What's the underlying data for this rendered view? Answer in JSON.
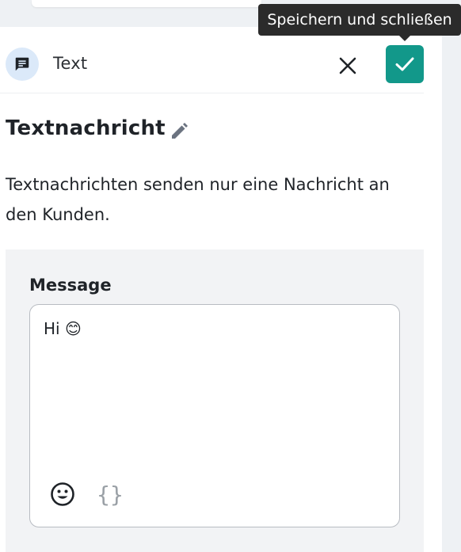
{
  "header": {
    "type_icon": "message-icon",
    "type_label": "Text",
    "close_icon": "close-icon",
    "save_icon": "check-icon",
    "save_tooltip": "Speichern und schließen"
  },
  "content": {
    "title": "Textnachricht",
    "edit_icon": "pencil-icon",
    "description": "Textnachrichten senden nur eine Nachricht an den Kunden."
  },
  "message": {
    "label": "Message",
    "value": "Hi 😊",
    "emoji_icon": "smiley-icon",
    "variables_icon": "curly-braces-icon",
    "variables_glyph": "{}"
  },
  "colors": {
    "accent": "#12988a",
    "badge_bg": "#dbe9f9",
    "section_bg": "#f2f3f5"
  }
}
